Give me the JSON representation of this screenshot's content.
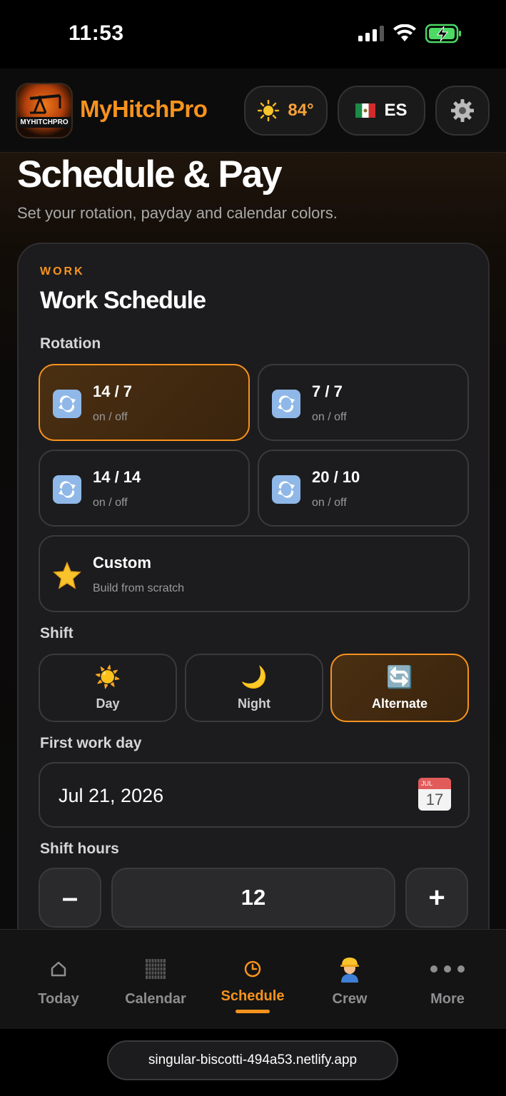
{
  "status_bar": {
    "time": "11:53",
    "icons": [
      "signal-icon",
      "wifi-icon",
      "battery-charging-icon"
    ]
  },
  "header": {
    "logo_text": "MYHITCHPRO",
    "app_name": "MyHitchPro",
    "weather": {
      "icon": "sun-icon",
      "temp": "84°"
    },
    "language": {
      "flag": "mexico-flag-icon",
      "code": "ES"
    },
    "settings_icon": "gear-icon"
  },
  "page": {
    "title": "Schedule & Pay",
    "subtitle": "Set your rotation, payday and calendar colors."
  },
  "card": {
    "kicker": "WORK",
    "title": "Work Schedule",
    "rotation_label": "Rotation",
    "rotations": [
      {
        "main": "14 / 7",
        "sub": "on / off",
        "icon": "repeat-icon",
        "selected": true
      },
      {
        "main": "7 / 7",
        "sub": "on / off",
        "icon": "repeat-icon",
        "selected": false
      },
      {
        "main": "14 / 14",
        "sub": "on / off",
        "icon": "repeat-icon",
        "selected": false
      },
      {
        "main": "20 / 10",
        "sub": "on / off",
        "icon": "repeat-icon",
        "selected": false
      },
      {
        "main": "Custom",
        "sub": "Build from scratch",
        "icon": "star-icon",
        "selected": false
      }
    ],
    "shift_label": "Shift",
    "shifts": [
      {
        "label": "Day",
        "icon": "sun-icon",
        "glyph": "☀️",
        "selected": false
      },
      {
        "label": "Night",
        "icon": "moon-icon",
        "glyph": "🌙",
        "selected": false
      },
      {
        "label": "Alternate",
        "icon": "cycle-icon",
        "glyph": "🔄",
        "selected": true
      }
    ],
    "first_day_label": "First work day",
    "first_day_value": "Jul 21, 2026",
    "calendar_icon": {
      "month": "JUL",
      "day": "17"
    },
    "shift_hours_label": "Shift hours",
    "shift_hours_value": "12",
    "decrement": "–",
    "increment": "+"
  },
  "tabs": [
    {
      "label": "Today",
      "icon": "home-icon",
      "active": false
    },
    {
      "label": "Calendar",
      "icon": "calendar-grid-icon",
      "active": false
    },
    {
      "label": "Schedule",
      "icon": "clock-icon",
      "active": true
    },
    {
      "label": "Crew",
      "icon": "construction-worker-icon",
      "active": false
    },
    {
      "label": "More",
      "icon": "more-dots-icon",
      "active": false
    }
  ],
  "browser": {
    "url": "singular-biscotti-494a53.netlify.app"
  },
  "colors": {
    "accent": "#f7931e",
    "background": "#0b0b0b",
    "card": "#1c1c1e"
  }
}
